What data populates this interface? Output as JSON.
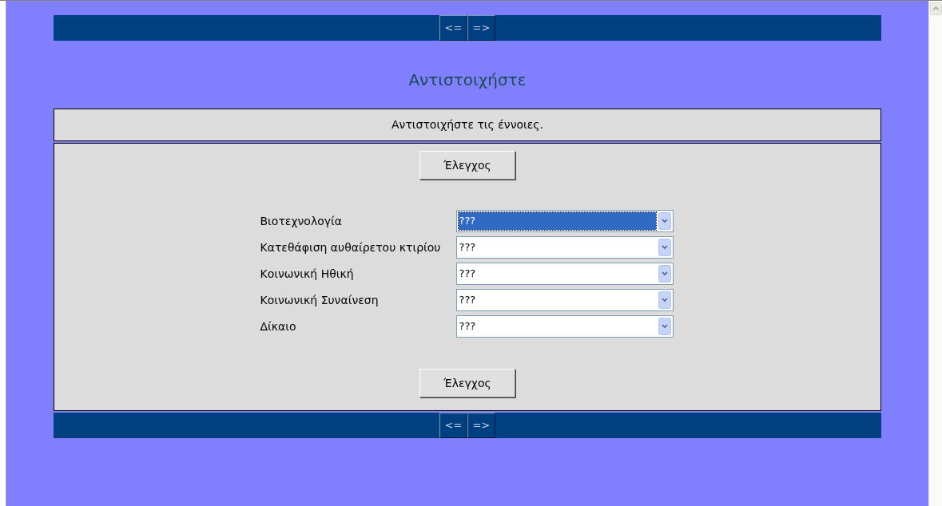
{
  "nav_top": {
    "buttons": [
      "<=",
      "=>"
    ]
  },
  "title": "Αντιστοιχήστε",
  "instruction": "Αντιστοιχήστε τις έννοιες.",
  "check_buttons": [
    "Έλεγχος",
    "Έλεγχος"
  ],
  "rows": [
    {
      "label": "Βιοτεχνολογία",
      "value": "???",
      "selected": true
    },
    {
      "label": "Κατεθάφιση αυθαίρετου κτιρίου",
      "value": "???",
      "selected": false
    },
    {
      "label": "Κοινωνική Ηθική",
      "value": "???",
      "selected": false
    },
    {
      "label": "Κοινωνική Συναίνεση",
      "value": "???",
      "selected": false
    },
    {
      "label": "Δίκαιο",
      "value": "???",
      "selected": false
    }
  ],
  "nav_bottom": {
    "buttons": [
      "<=",
      "=>"
    ]
  }
}
